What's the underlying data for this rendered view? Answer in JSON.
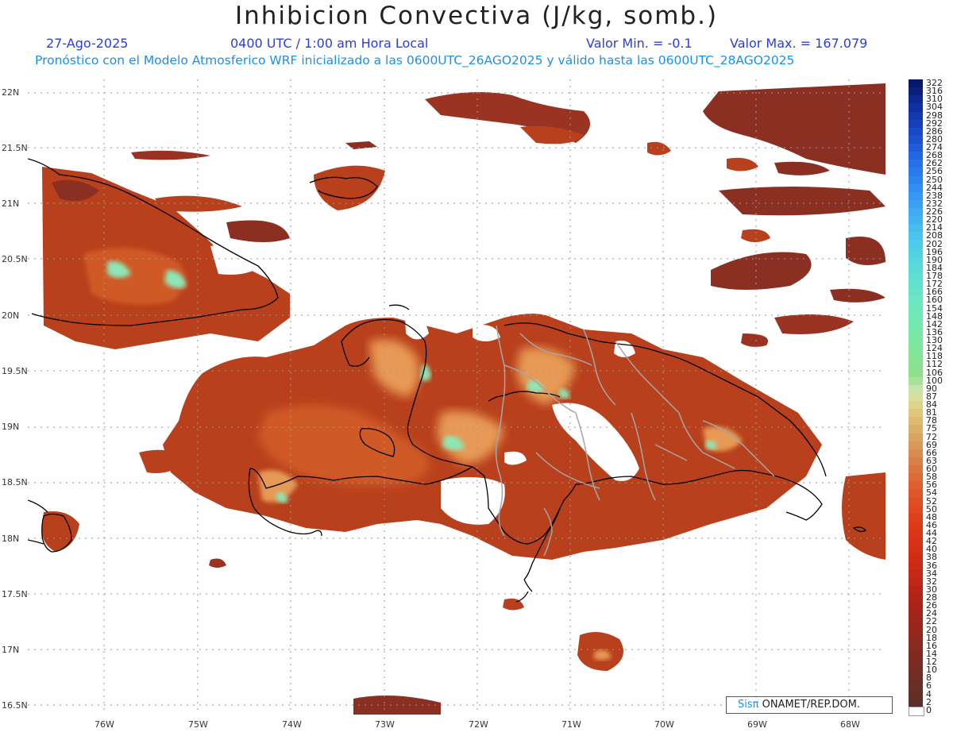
{
  "header": {
    "title": "Inhibicion Convectiva (J/kg, somb.)",
    "date": "27-Ago-2025",
    "time": "0400 UTC / 1:00 am Hora Local",
    "valor_min": "Valor Min. = -0.1",
    "valor_max": "Valor Max. = 167.079",
    "model_info": "Pronóstico con el Modelo Atmosferico WRF inicializado a las 0600UTC_26AGO2025 y válido hasta las  0600UTC_28AGO2025"
  },
  "lat_labels": [
    "22N",
    "21.5N",
    "21N",
    "20.5N",
    "20N",
    "19.5N",
    "19N",
    "18.5N",
    "18N",
    "17.5N",
    "17N",
    "16.5N"
  ],
  "lon_labels": [
    "76W",
    "75W",
    "74W",
    "73W",
    "72W",
    "71W",
    "70W",
    "69W",
    "68W"
  ],
  "legend": {
    "labels": [
      "322",
      "316",
      "310",
      "304",
      "298",
      "292",
      "286",
      "280",
      "274",
      "268",
      "262",
      "256",
      "250",
      "244",
      "238",
      "232",
      "226",
      "220",
      "214",
      "208",
      "202",
      "196",
      "190",
      "184",
      "178",
      "172",
      "166",
      "160",
      "154",
      "148",
      "142",
      "136",
      "130",
      "124",
      "118",
      "112",
      "106",
      "100",
      "90",
      "87",
      "84",
      "81",
      "78",
      "75",
      "72",
      "69",
      "66",
      "63",
      "60",
      "58",
      "56",
      "54",
      "52",
      "50",
      "48",
      "46",
      "44",
      "42",
      "40",
      "38",
      "36",
      "34",
      "32",
      "30",
      "28",
      "26",
      "24",
      "22",
      "20",
      "18",
      "16",
      "14",
      "12",
      "10",
      "8",
      "6",
      "4",
      "2",
      "0"
    ],
    "colors": [
      "#07176b",
      "#0a1f7e",
      "#0d2890",
      "#1030a2",
      "#1338b0",
      "#163fbd",
      "#1948c8",
      "#1c52d2",
      "#1f5cdb",
      "#2266e2",
      "#2670e8",
      "#2a7aec",
      "#2e84ef",
      "#328ef1",
      "#3698f2",
      "#3aa1f2",
      "#3eabf2",
      "#42b4f1",
      "#46bcef",
      "#4ac4ec",
      "#4ecbe8",
      "#52d1e3",
      "#56d6de",
      "#5adbd8",
      "#5edfd2",
      "#62e2cc",
      "#66e4c6",
      "#6ae6c0",
      "#6ee7ba",
      "#72e8b4",
      "#76e8ae",
      "#7ae8a8",
      "#7ee7a2",
      "#82e69c",
      "#86e496",
      "#8ae290",
      "#8ee08a",
      "#a8e0a0",
      "#c8e2a8",
      "#d8df9a",
      "#dcd48a",
      "#ddc87c",
      "#dcbb70",
      "#dab068",
      "#d9a460",
      "#d89858",
      "#d88c50",
      "#d88048",
      "#d97440",
      "#da6a38",
      "#dc6030",
      "#dd562a",
      "#de4e24",
      "#de471f",
      "#dd411c",
      "#dc3b19",
      "#da3617",
      "#d83216",
      "#d52f15",
      "#d02c15",
      "#cb2a16",
      "#c52816",
      "#be2617",
      "#b82517",
      "#b12418",
      "#aa2419",
      "#a3251a",
      "#9c261b",
      "#95271d",
      "#8e281e",
      "#872a20",
      "#802b21",
      "#7a2c23",
      "#742d24",
      "#6e2e25",
      "#682f26",
      "#622f27",
      "#5c2f28",
      "#ffffff"
    ]
  },
  "credit": {
    "sis": "Sisπ",
    "text": " ONAMET/REP.DOM."
  },
  "colors": {
    "field_main": "#b8401c",
    "field_dark": "#8b2f22",
    "field_mid": "#d05a28",
    "field_light": "#e79a55",
    "field_high": "#8ee6b6",
    "coast": "#000000",
    "borders": "#a0a0a0"
  }
}
